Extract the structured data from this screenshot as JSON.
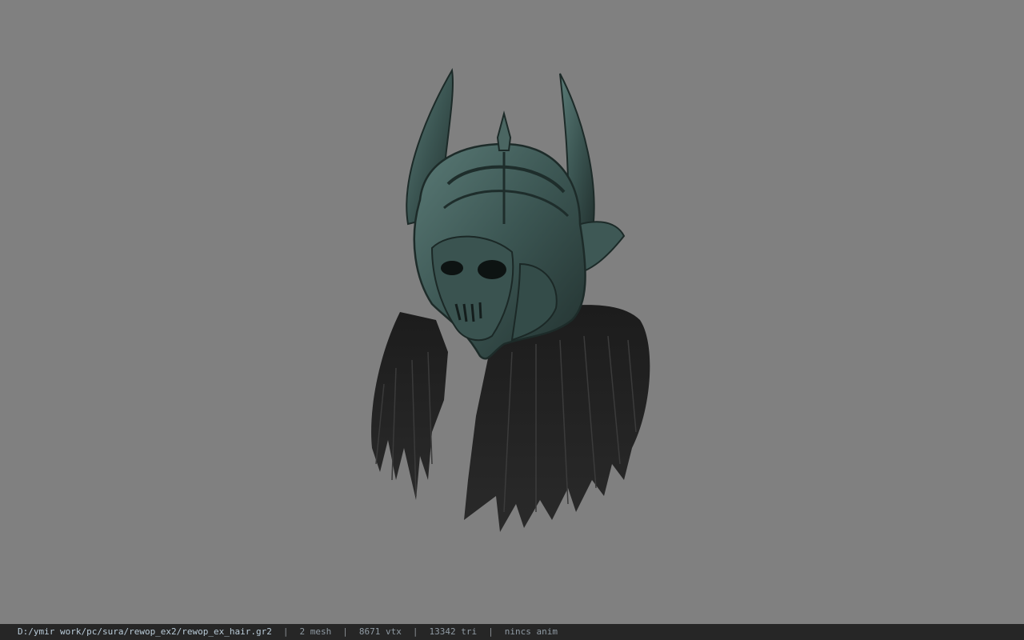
{
  "viewport": {
    "background": "#808080",
    "model_name": "helmet-with-hair-model"
  },
  "statusbar": {
    "path": "D:/ymir work/pc/sura/rewop_ex2/rewop_ex_hair.gr2",
    "separator": "|",
    "mesh": "2 mesh",
    "vertices": "8671 vtx",
    "triangles": "13342 tri",
    "animation": "nincs anim"
  }
}
